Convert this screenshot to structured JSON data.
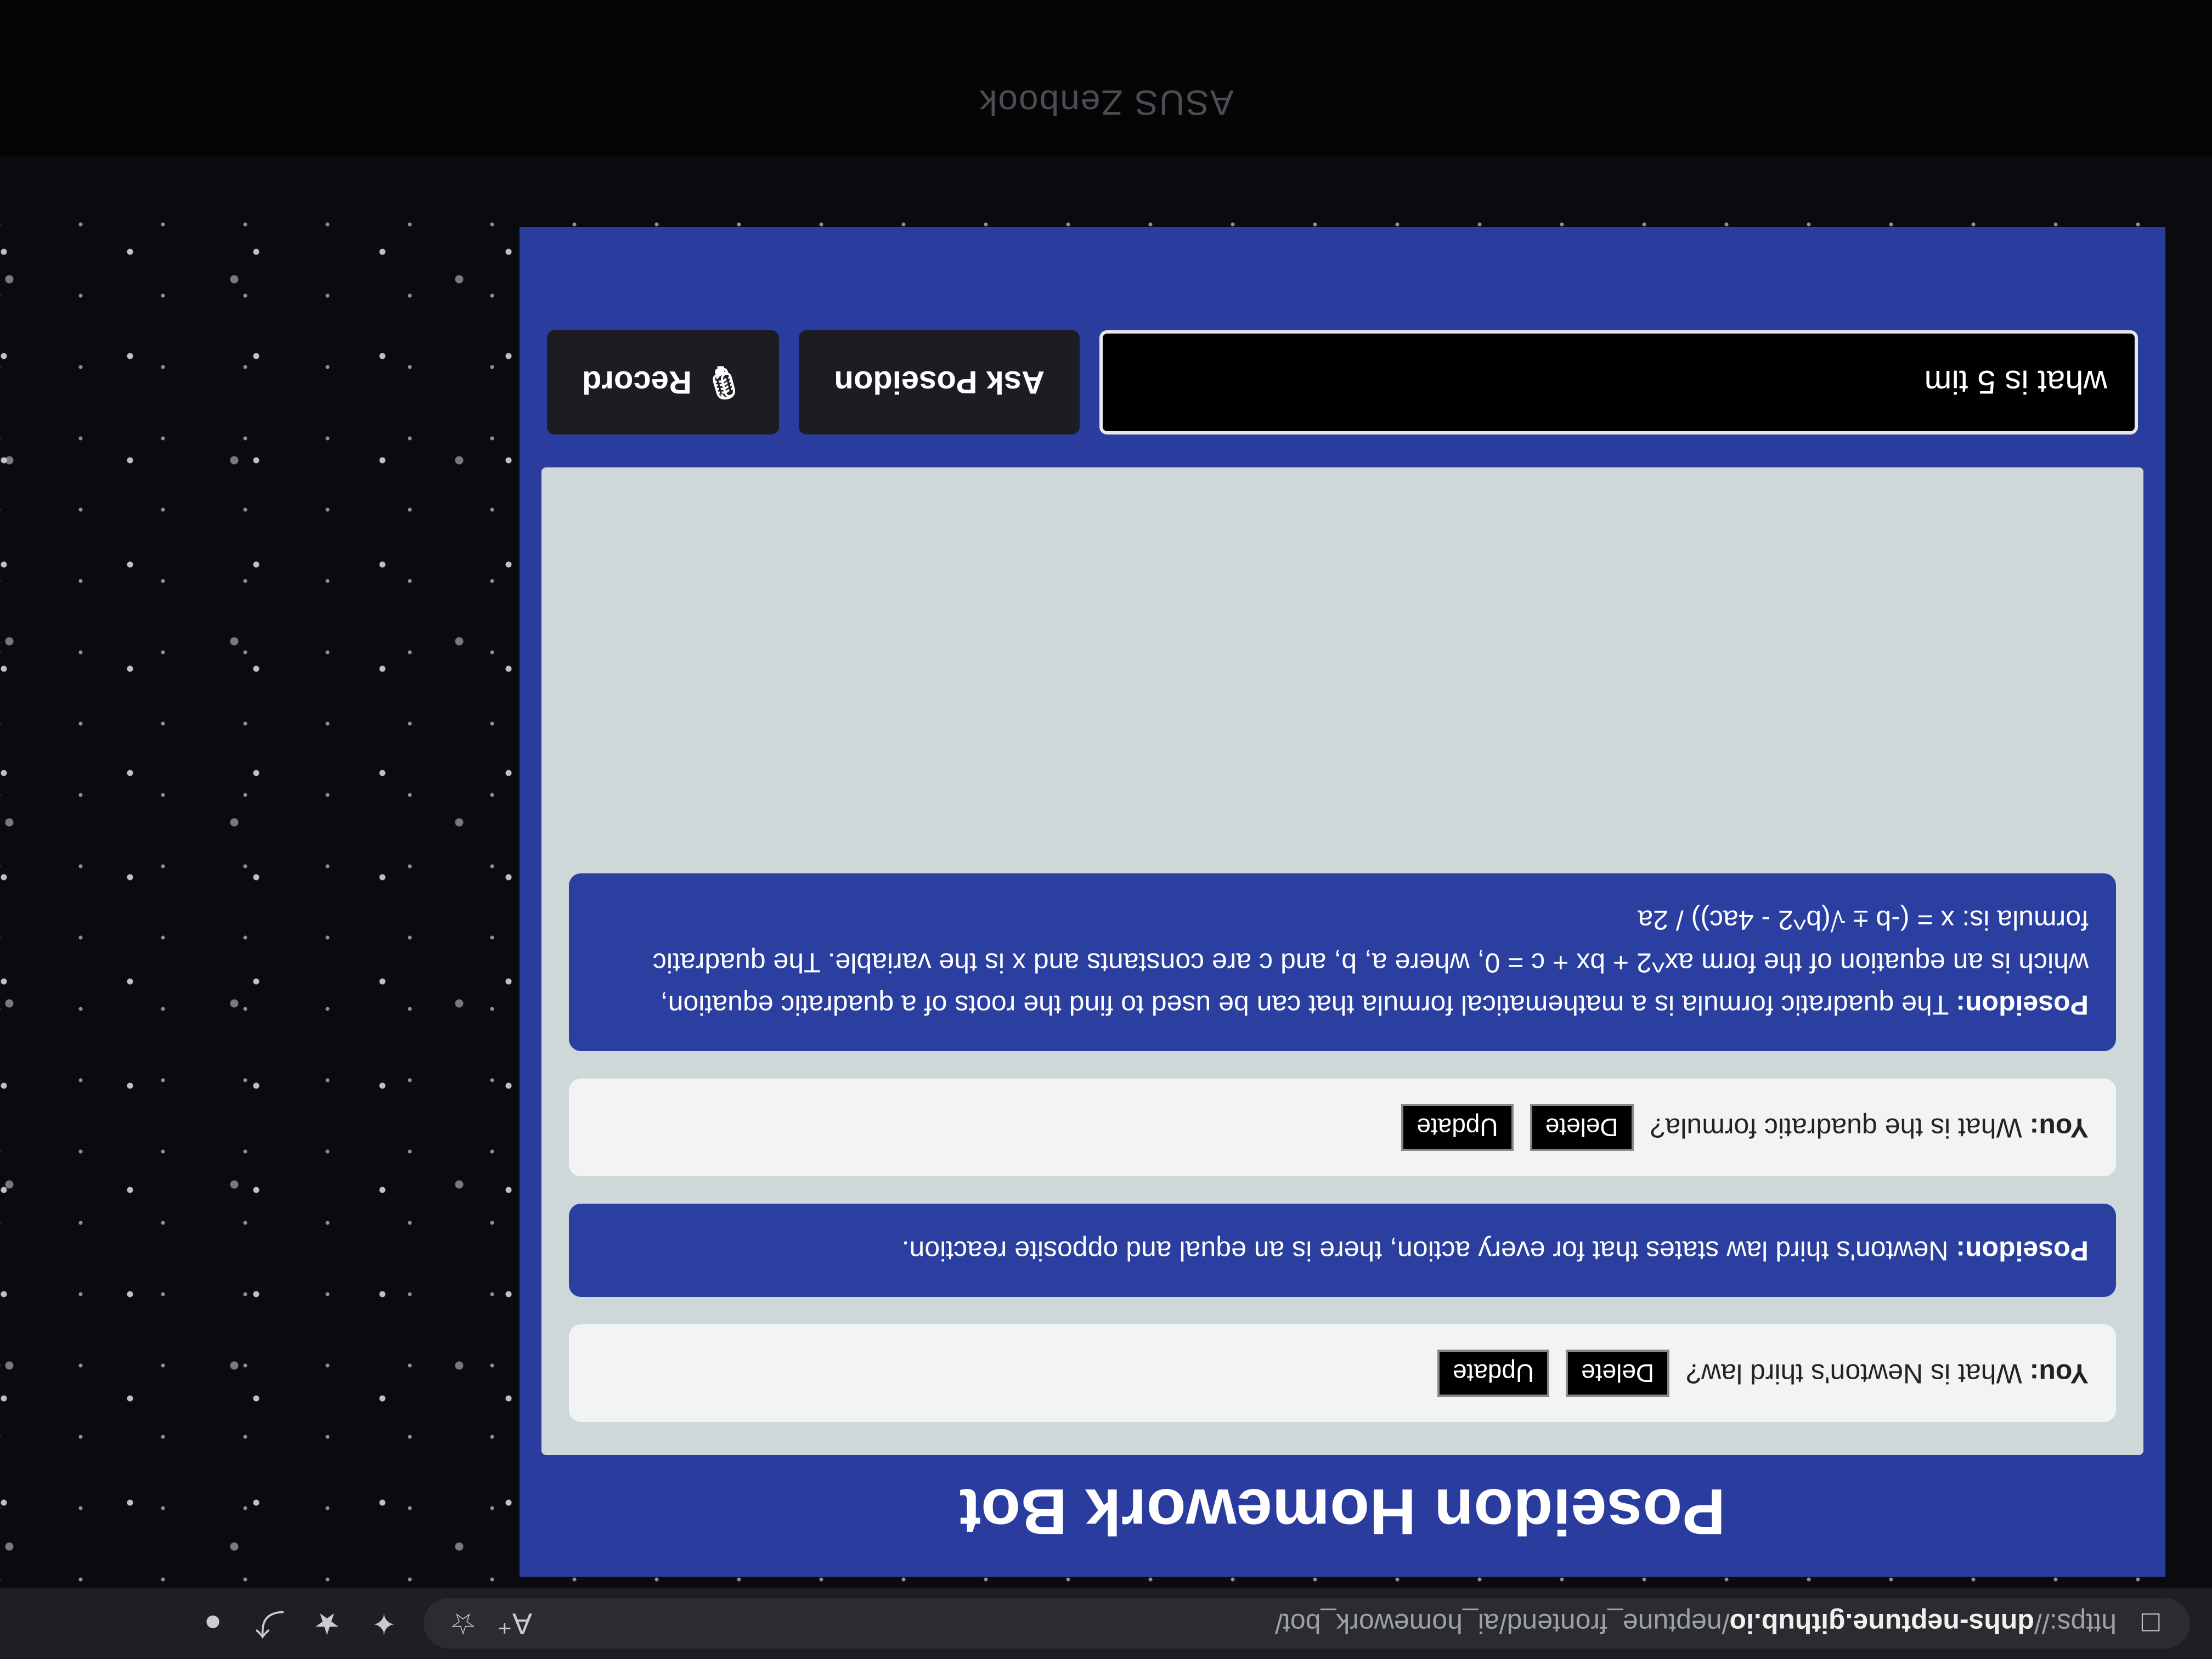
{
  "browser": {
    "url_scheme": "https://",
    "url_host": "dnhs-neptune.github.io",
    "url_path": "/neptune_frontend/ai_homework_bot/"
  },
  "app": {
    "title": "Poseidon Homework Bot",
    "messages": [
      {
        "sender": "You:",
        "text": " What is Newton's third law?",
        "delete_label": "Delete",
        "update_label": "Update"
      },
      {
        "sender": "Poseidon:",
        "text": " Newton's third law states that for every action, there is an equal and opposite reaction."
      },
      {
        "sender": "You:",
        "text": " What is the quadratic formula?",
        "delete_label": "Delete",
        "update_label": "Update"
      },
      {
        "sender": "Poseidon:",
        "text": " The quadratic formula is a mathematical formula that can be used to find the roots of a quadratic equation, which is an equation of the form ax^2 + bx + c = 0, where a, b, and c are constants and x is the variable. The quadratic formula is: x = (-b ± √(b^2 - 4ac)) / 2a"
      }
    ],
    "input_value": "what is 5 tim",
    "ask_label": "Ask Poseidon",
    "record_label": "Record"
  },
  "device": {
    "brand": "ASUS Zenbook"
  },
  "icons": {
    "site_info": "site-info-icon",
    "read_aloud": "read-aloud-icon",
    "favorite": "favorite-icon",
    "extensions": "extensions-icon",
    "favorites_bar": "favorites-bar-icon",
    "pin": "pin-icon",
    "profile": "profile-icon",
    "microphone": "microphone-icon"
  },
  "colors": {
    "app_background": "#2a3c9e",
    "chat_background": "#cfd8d9",
    "user_bubble": "#f2f4f4",
    "bot_bubble": "#2b3fa1"
  }
}
